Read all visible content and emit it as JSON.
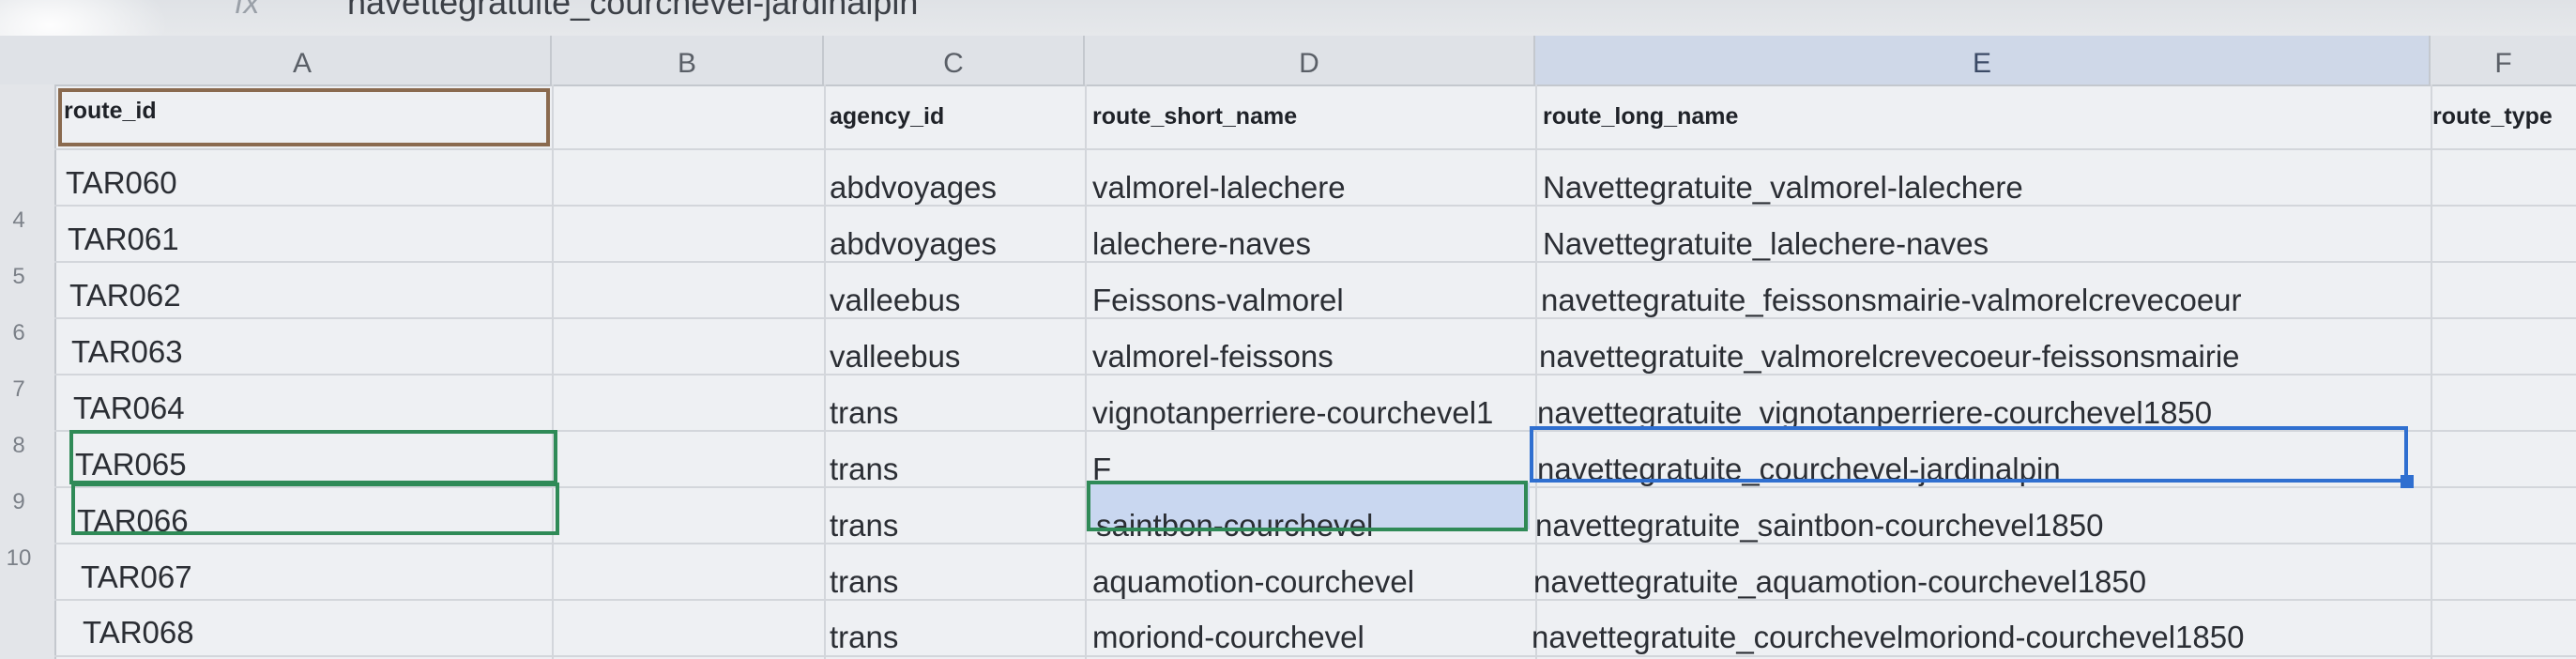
{
  "formula_bar": {
    "fx": "fx",
    "content": "navettegratuite_courchevel-jardinalpin"
  },
  "columns": [
    {
      "letter": "A"
    },
    {
      "letter": "B"
    },
    {
      "letter": "C"
    },
    {
      "letter": "D"
    },
    {
      "letter": "E"
    },
    {
      "letter": "F"
    }
  ],
  "header": {
    "route_id": "route_id",
    "agency_id": "agency_id",
    "route_short_name": "route_short_name",
    "route_long_name": "route_long_name",
    "route_type": "route_type"
  },
  "row_numbers": [
    "",
    "",
    "",
    "4",
    "5",
    "6",
    "7",
    "8",
    "9",
    "10"
  ],
  "rows": [
    {
      "route_id": "TAR060",
      "agency_id": "abdvoyages",
      "route_short_name": "valmorel-lalechere",
      "route_long_name": "Navettegratuite_valmorel-lalechere"
    },
    {
      "route_id": "TAR061",
      "agency_id": "abdvoyages",
      "route_short_name": "lalechere-naves",
      "route_long_name": "Navettegratuite_lalechere-naves"
    },
    {
      "route_id": "TAR062",
      "agency_id": "valleebus",
      "route_short_name": "Feissons-valmorel",
      "route_long_name": "navettegratuite_feissonsmairie-valmorelcrevecoeur"
    },
    {
      "route_id": "TAR063",
      "agency_id": "valleebus",
      "route_short_name": "valmorel-feissons",
      "route_long_name": "navettegratuite_valmorelcrevecoeur-feissonsmairie"
    },
    {
      "route_id": "TAR064",
      "agency_id": "trans",
      "route_short_name": "vignotanperriere-courchevel1",
      "route_long_name": "navettegratuite_vignotanperriere-courchevel1850"
    },
    {
      "route_id": "TAR065",
      "agency_id": "trans",
      "route_short_name": "F",
      "route_long_name": "navettegratuite_courchevel-jardinalpin"
    },
    {
      "route_id": "TAR066",
      "agency_id": "trans",
      "route_short_name": "saintbon-courchevel",
      "route_long_name": "navettegratuite_saintbon-courchevel1850"
    },
    {
      "route_id": "TAR067",
      "agency_id": "trans",
      "route_short_name": "aquamotion-courchevel",
      "route_long_name": "navettegratuite_aquamotion-courchevel1850"
    },
    {
      "route_id": "TAR068",
      "agency_id": "trans",
      "route_short_name": "moriond-courchevel",
      "route_long_name": "navettegratuite_courchevelmoriond-courchevel1850"
    }
  ],
  "colors": {
    "selection_green": "#2f8a57",
    "selection_blue": "#2f6fd0",
    "selection_brown": "#8a6a4f",
    "highlight_fill": "#c9d7f0"
  }
}
